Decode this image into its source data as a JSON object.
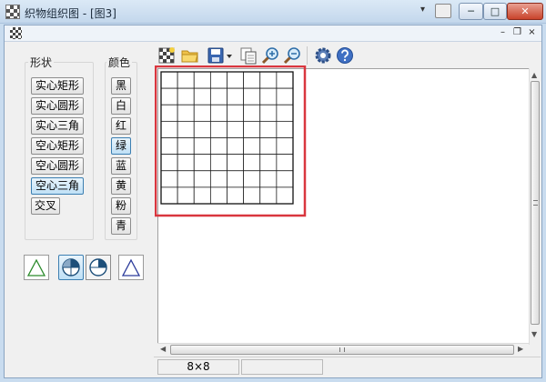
{
  "window": {
    "title": "织物组织图 - [图3]",
    "min_glyph": "─",
    "max_glyph": "□",
    "close_glyph": "✕",
    "extra_glyph": "▾"
  },
  "mdi": {
    "min_glyph": "–",
    "restore_glyph": "❐",
    "close_glyph": "×"
  },
  "shapes": {
    "label": "形状",
    "items": [
      {
        "label": "实心矩形",
        "selected": false
      },
      {
        "label": "实心圆形",
        "selected": false
      },
      {
        "label": "实心三角",
        "selected": false
      },
      {
        "label": "空心矩形",
        "selected": false
      },
      {
        "label": "空心圆形",
        "selected": false
      },
      {
        "label": "空心三角",
        "selected": true
      },
      {
        "label": "交叉",
        "selected": false
      }
    ]
  },
  "colors": {
    "label": "颜色",
    "items": [
      {
        "label": "黑",
        "selected": false
      },
      {
        "label": "白",
        "selected": false
      },
      {
        "label": "红",
        "selected": false
      },
      {
        "label": "绿",
        "selected": true
      },
      {
        "label": "蓝",
        "selected": false
      },
      {
        "label": "黄",
        "selected": false
      },
      {
        "label": "粉",
        "selected": false
      },
      {
        "label": "青",
        "selected": false
      }
    ]
  },
  "grid": {
    "rows": 8,
    "cols": 8,
    "highlight_color": "#d9363e"
  },
  "status": {
    "grid_size": "8×8"
  },
  "icons": [
    "new-pattern-icon",
    "open-folder-icon",
    "save-icon",
    "copy-icon",
    "zoom-in-icon",
    "zoom-out-icon",
    "settings-gear-icon",
    "help-icon"
  ]
}
